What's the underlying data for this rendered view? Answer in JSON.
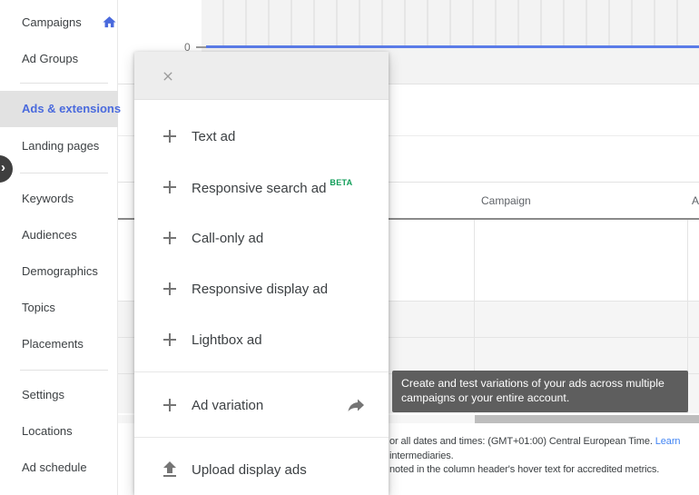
{
  "colors": {
    "nav_selected_blue": "#4a6add",
    "chart_line_blue": "#5b7ce8",
    "beta_green": "#0f9d58",
    "link_blue": "#4285f4",
    "tooltip_bg": "#5e5e5e",
    "selected_item_bg": "#e2e2e2"
  },
  "sidebar": {
    "items": [
      {
        "label": "Campaigns",
        "icon": "home-icon"
      },
      {
        "label": "Ad Groups"
      },
      {
        "label": "Ads & extensions",
        "selected": true
      },
      {
        "label": "Landing pages"
      },
      {
        "label": "Keywords"
      },
      {
        "label": "Audiences"
      },
      {
        "label": "Demographics"
      },
      {
        "label": "Topics"
      },
      {
        "label": "Placements"
      },
      {
        "label": "Settings"
      },
      {
        "label": "Locations"
      },
      {
        "label": "Ad schedule"
      }
    ],
    "collapse_chevron": "›"
  },
  "chart": {
    "y_tick": "0",
    "note": "flat blue line at zero across date axis"
  },
  "table": {
    "columns": [
      {
        "label": "Campaign"
      },
      {
        "label": "A"
      }
    ]
  },
  "menu": {
    "items": [
      {
        "label": "Text ad",
        "icon": "plus-icon"
      },
      {
        "label": "Responsive search ad",
        "icon": "plus-icon",
        "badge": "BETA"
      },
      {
        "label": "Call-only ad",
        "icon": "plus-icon"
      },
      {
        "label": "Responsive display ad",
        "icon": "plus-icon"
      },
      {
        "label": "Lightbox ad",
        "icon": "plus-icon"
      },
      {
        "label": "Ad variation",
        "icon": "plus-icon",
        "trailing_icon": "forward-arrow-icon"
      },
      {
        "label": "Upload display ads",
        "icon": "upload-icon"
      }
    ]
  },
  "tooltip": {
    "text": "Create and test variations of your ads across multiple campaigns or your entire account."
  },
  "footer": {
    "line1": "or all dates and times: (GMT+01:00) Central European Time. ",
    "line1_link": "Learn",
    "line2": "intermediaries.",
    "line3": "noted in the column header's hover text for accredited metrics."
  }
}
